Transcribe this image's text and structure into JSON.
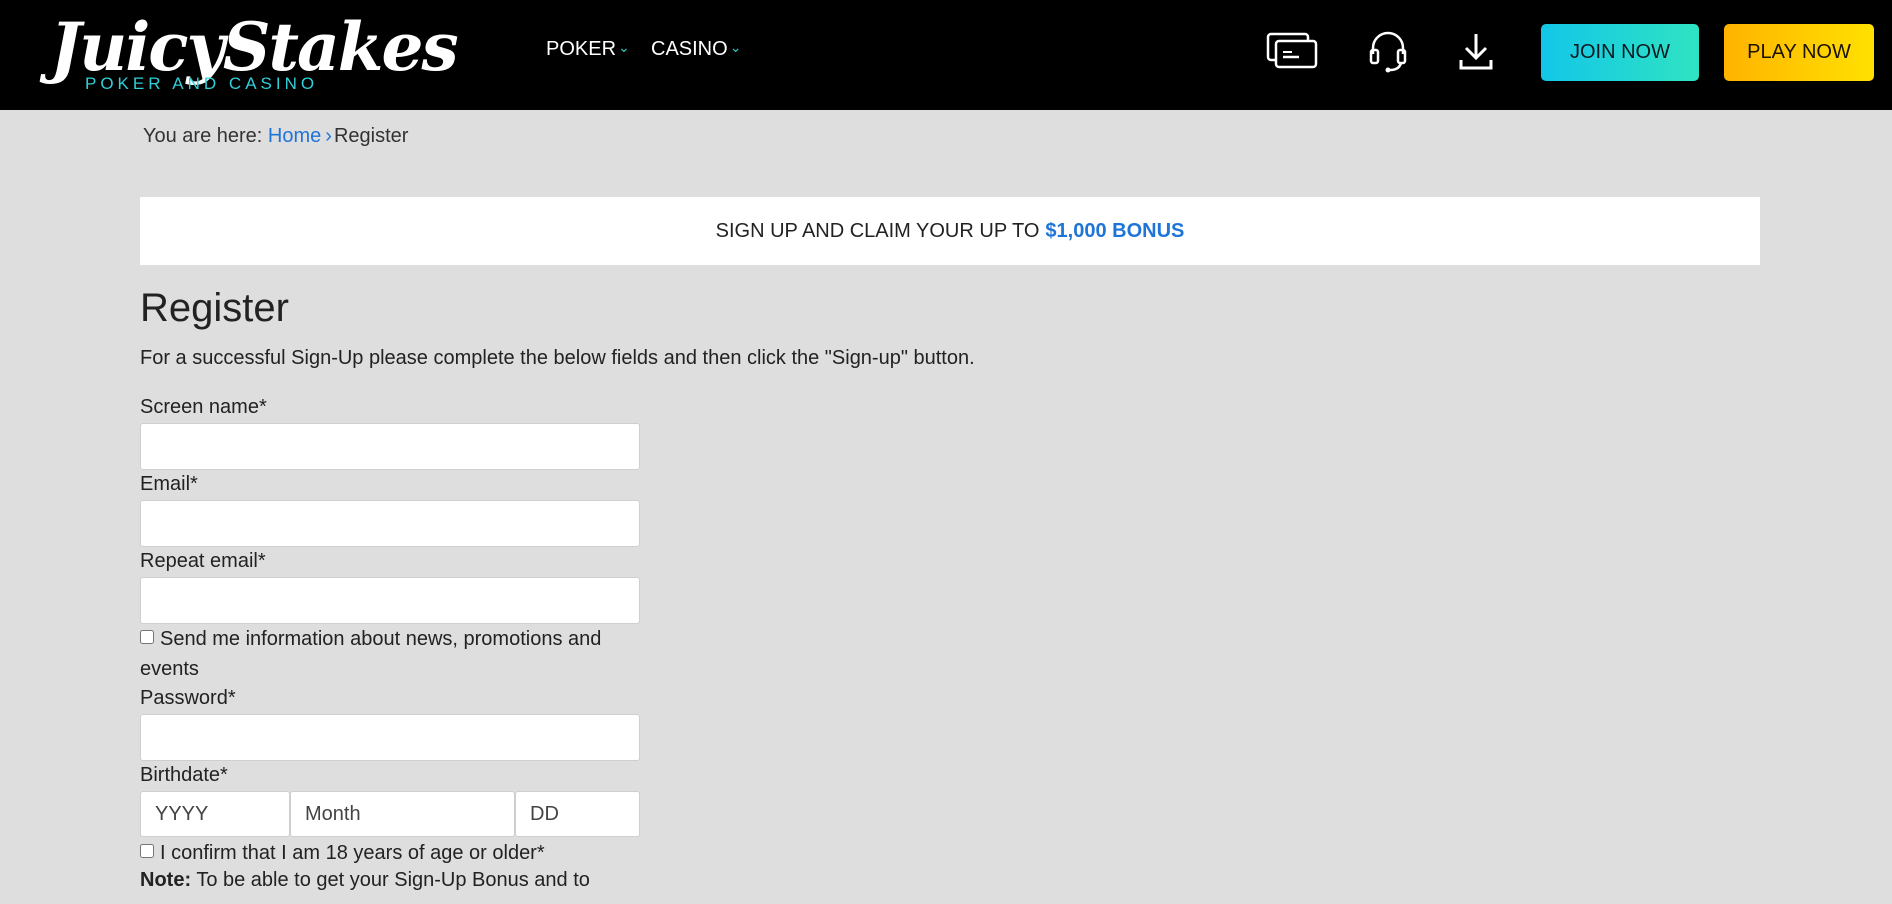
{
  "header": {
    "logo": {
      "word": "JuicyStakes",
      "sub": "POKER AND CASINO"
    },
    "nav": [
      {
        "label": "POKER"
      },
      {
        "label": "CASINO"
      }
    ],
    "icons": [
      "cashier-cards-icon",
      "support-headset-icon",
      "download-icon"
    ],
    "join_label": "JOIN NOW",
    "play_label": "PLAY NOW",
    "colors": {
      "join": "#13c6e8",
      "play": "#ffc400",
      "accent": "#2fd0d8"
    }
  },
  "breadcrumb": {
    "prefix": "You are here:",
    "home": "Home",
    "separator": "›",
    "current": "Register"
  },
  "promo": {
    "text": "SIGN UP AND CLAIM YOUR UP TO",
    "bonus": "$1,000 BONUS"
  },
  "form": {
    "title": "Register",
    "intro": "For a successful Sign-Up please complete the below fields and then click the \"Sign-up\" button.",
    "screen_name_label": "Screen name*",
    "email_label": "Email*",
    "repeat_email_label": "Repeat email*",
    "newsletter_label": "Send me information about news, promotions and events",
    "password_label": "Password*",
    "birthdate_label": "Birthdate*",
    "birth_year_placeholder": "YYYY",
    "birth_month_placeholder": "Month",
    "birth_day_placeholder": "DD",
    "age_confirm_label": "I confirm that I am 18 years of age or older*",
    "note_bold": "Note:",
    "note_text": "To be able to get your Sign-Up Bonus and to"
  }
}
